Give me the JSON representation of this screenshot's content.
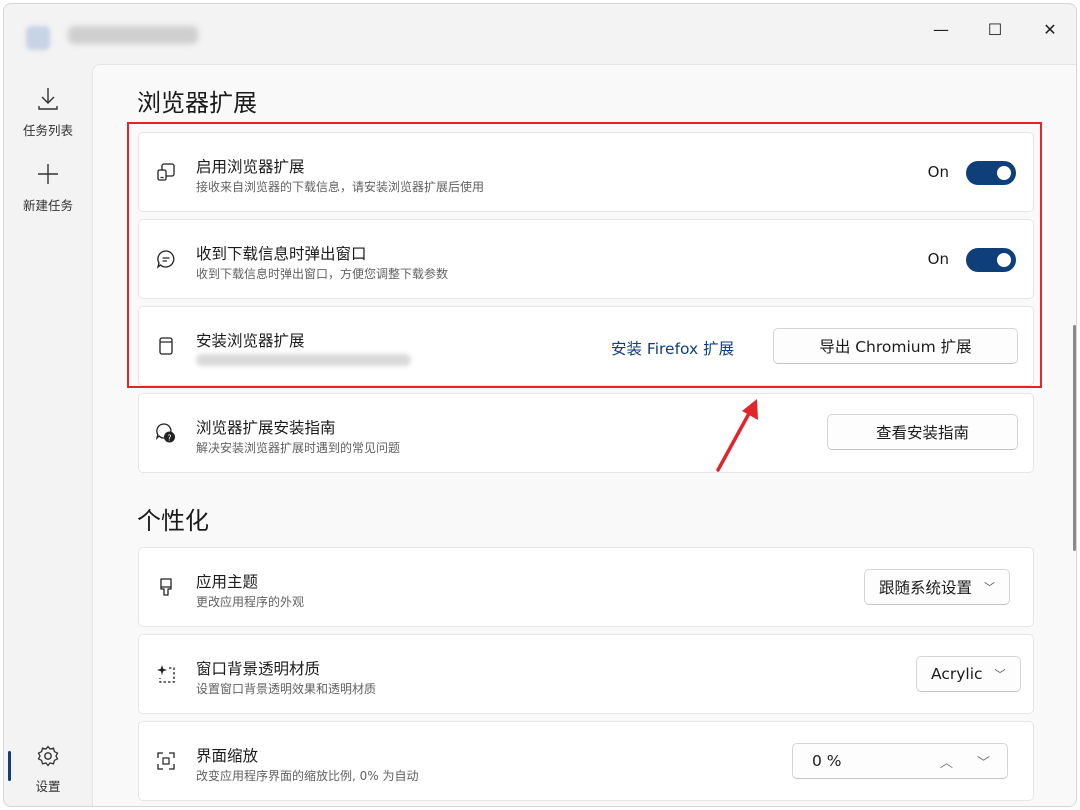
{
  "window": {
    "controls": {
      "minimize": "—",
      "maximize": "☐",
      "close": "✕"
    }
  },
  "sidebar": {
    "items": [
      {
        "label": "任务列表",
        "icon": "download-icon"
      },
      {
        "label": "新建任务",
        "icon": "plus-icon"
      },
      {
        "label": "设置",
        "icon": "gear-icon"
      }
    ]
  },
  "browser_extension": {
    "title": "浏览器扩展",
    "enable": {
      "title": "启用浏览器扩展",
      "desc": "接收来自浏览器的下载信息，请安装浏览器扩展后使用",
      "state": "On"
    },
    "popup": {
      "title": "收到下载信息时弹出窗口",
      "desc": "收到下载信息时弹出窗口，方便您调整下载参数",
      "state": "On"
    },
    "install": {
      "title": "安装浏览器扩展",
      "firefox_link": "安装 Firefox 扩展",
      "chromium_button": "导出 Chromium 扩展"
    },
    "guide": {
      "title": "浏览器扩展安装指南",
      "desc": "解决安装浏览器扩展时遇到的常见问题",
      "button": "查看安装指南"
    }
  },
  "personalization": {
    "title": "个性化",
    "theme": {
      "title": "应用主题",
      "desc": "更改应用程序的外观",
      "value": "跟随系统设置"
    },
    "backdrop": {
      "title": "窗口背景透明材质",
      "desc": "设置窗口背景透明效果和透明材质",
      "value": "Acrylic"
    },
    "scale": {
      "title": "界面缩放",
      "desc": "改变应用程序界面的缩放比例, 0% 为自动",
      "value": "0 %"
    }
  },
  "colors": {
    "accent": "#0f3f7a",
    "annotation": "#e0262a"
  }
}
